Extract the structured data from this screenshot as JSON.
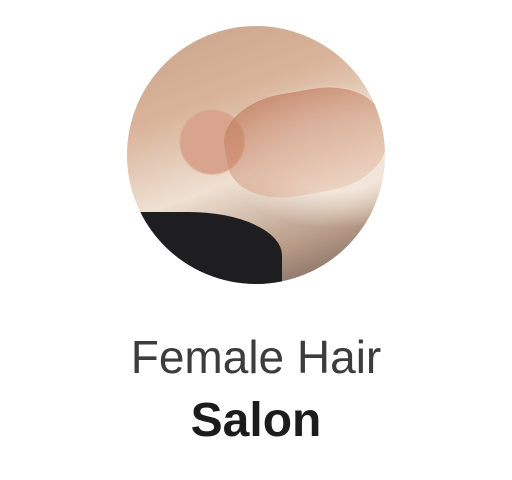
{
  "category": {
    "title_line1": "Female Hair",
    "title_line2": "Salon"
  }
}
